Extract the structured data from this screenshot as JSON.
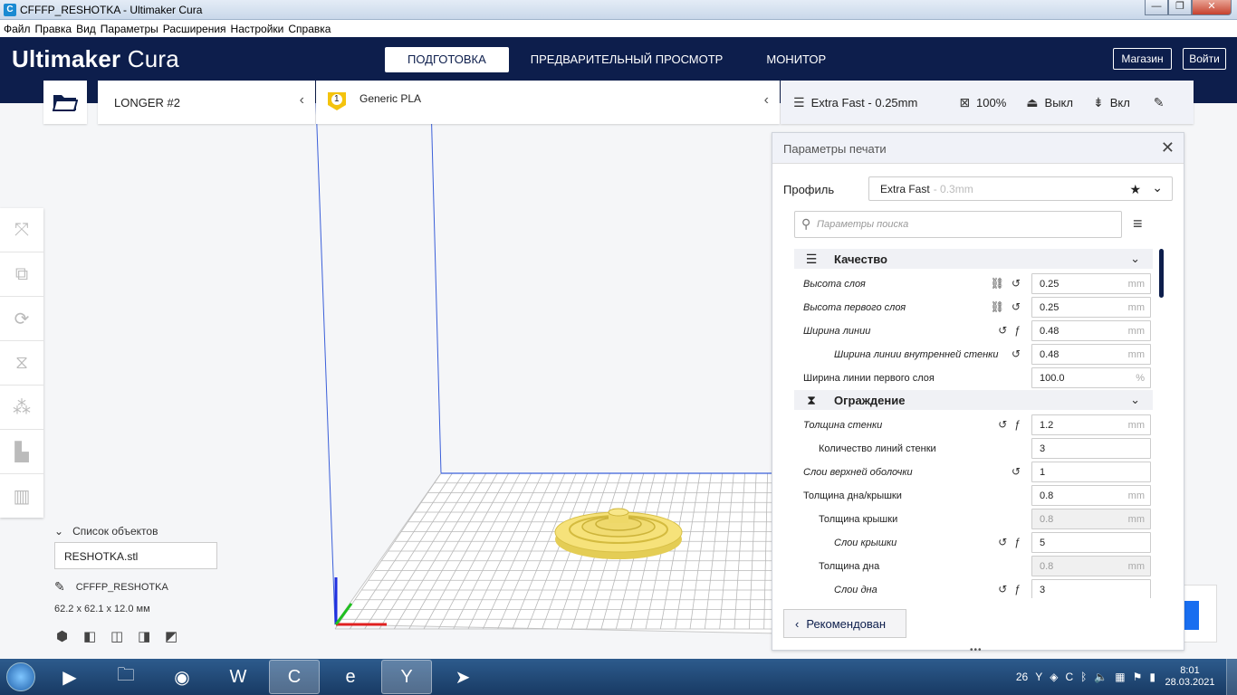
{
  "window": {
    "title": "CFFFP_RESHOTKA - Ultimaker Cura",
    "app_icon": "C",
    "minimize": "—",
    "maximize": "❐",
    "close": "✕"
  },
  "menu": [
    "Файл",
    "Правка",
    "Вид",
    "Параметры",
    "Расширения",
    "Настройки",
    "Справка"
  ],
  "header": {
    "logo_bold": "Ultimaker",
    "logo_light": " Cura",
    "tabs": [
      {
        "label": "ПОДГОТОВКА",
        "active": true
      },
      {
        "label": "ПРЕДВАРИТЕЛЬНЫЙ ПРОСМОТР",
        "active": false
      },
      {
        "label": "МОНИТОР",
        "active": false
      }
    ],
    "marketplace": "Магазин",
    "login": "Войти"
  },
  "topbar": {
    "printer": "LONGER #2",
    "extruder_number": "1",
    "material": "Generic PLA",
    "profile": "Extra Fast - 0.25mm",
    "infill": "100%",
    "support": "Выкл",
    "adhesion": "Вкл"
  },
  "panel": {
    "title": "Параметры печати",
    "profile_label": "Профиль",
    "profile_value": "Extra Fast",
    "profile_sub": "- 0.3mm",
    "search_placeholder": "Параметры поиска",
    "recommended": "Рекомендован",
    "categories": [
      {
        "name": "Качество",
        "icon": "quality-icon",
        "rows": [
          {
            "label": "Высота слоя",
            "italic": true,
            "indent": 0,
            "icons": [
              "link",
              "reset"
            ],
            "value": "0.25",
            "unit": "mm",
            "disabled": false
          },
          {
            "label": "Высота первого слоя",
            "italic": true,
            "indent": 0,
            "icons": [
              "link",
              "reset"
            ],
            "value": "0.25",
            "unit": "mm",
            "disabled": false
          },
          {
            "label": "Ширина линии",
            "italic": true,
            "indent": 0,
            "icons": [
              "reset",
              "function"
            ],
            "value": "0.48",
            "unit": "mm",
            "disabled": false
          },
          {
            "label": "Ширина линии внутренней стенки",
            "italic": true,
            "indent": 2,
            "icons": [
              "reset"
            ],
            "value": "0.48",
            "unit": "mm",
            "disabled": false
          },
          {
            "label": "Ширина линии первого слоя",
            "italic": false,
            "indent": 0,
            "icons": [],
            "value": "100.0",
            "unit": "%",
            "disabled": false
          }
        ]
      },
      {
        "name": "Ограждение",
        "icon": "shell-icon",
        "rows": [
          {
            "label": "Толщина стенки",
            "italic": true,
            "indent": 0,
            "icons": [
              "reset",
              "function"
            ],
            "value": "1.2",
            "unit": "mm",
            "disabled": false
          },
          {
            "label": "Количество линий стенки",
            "italic": false,
            "indent": 1,
            "icons": [],
            "value": "3",
            "unit": "",
            "disabled": false
          },
          {
            "label": "Слои верхней оболочки",
            "italic": true,
            "indent": 0,
            "icons": [
              "reset"
            ],
            "value": "1",
            "unit": "",
            "disabled": false
          },
          {
            "label": "Толщина дна/крышки",
            "italic": false,
            "indent": 0,
            "icons": [],
            "value": "0.8",
            "unit": "mm",
            "disabled": false
          },
          {
            "label": "Толщина крышки",
            "italic": false,
            "indent": 1,
            "icons": [],
            "value": "0.8",
            "unit": "mm",
            "disabled": true
          },
          {
            "label": "Слои крышки",
            "italic": true,
            "indent": 2,
            "icons": [
              "reset",
              "function"
            ],
            "value": "5",
            "unit": "",
            "disabled": false
          },
          {
            "label": "Толщина дна",
            "italic": false,
            "indent": 1,
            "icons": [],
            "value": "0.8",
            "unit": "mm",
            "disabled": true
          },
          {
            "label": "Слои дна",
            "italic": true,
            "indent": 2,
            "icons": [
              "reset",
              "function"
            ],
            "value": "3",
            "unit": "",
            "disabled": false
          }
        ]
      }
    ]
  },
  "objects": {
    "header": "Список объектов",
    "file": "RESHOTKA.stl",
    "model_name": "CFFFP_RESHOTKA",
    "dimensions": "62.2 x 62.1 x 12.0 мм"
  },
  "taskbar": {
    "tray_badge": "26",
    "time": "8:01",
    "date": "28.03.2021"
  },
  "colors": {
    "header_bg": "#0d1e4c",
    "accent_blue": "#196ef0",
    "model_yellow": "#f3e27a",
    "axis_x": "#e02020",
    "axis_y": "#20c020",
    "axis_z": "#2030e0"
  }
}
